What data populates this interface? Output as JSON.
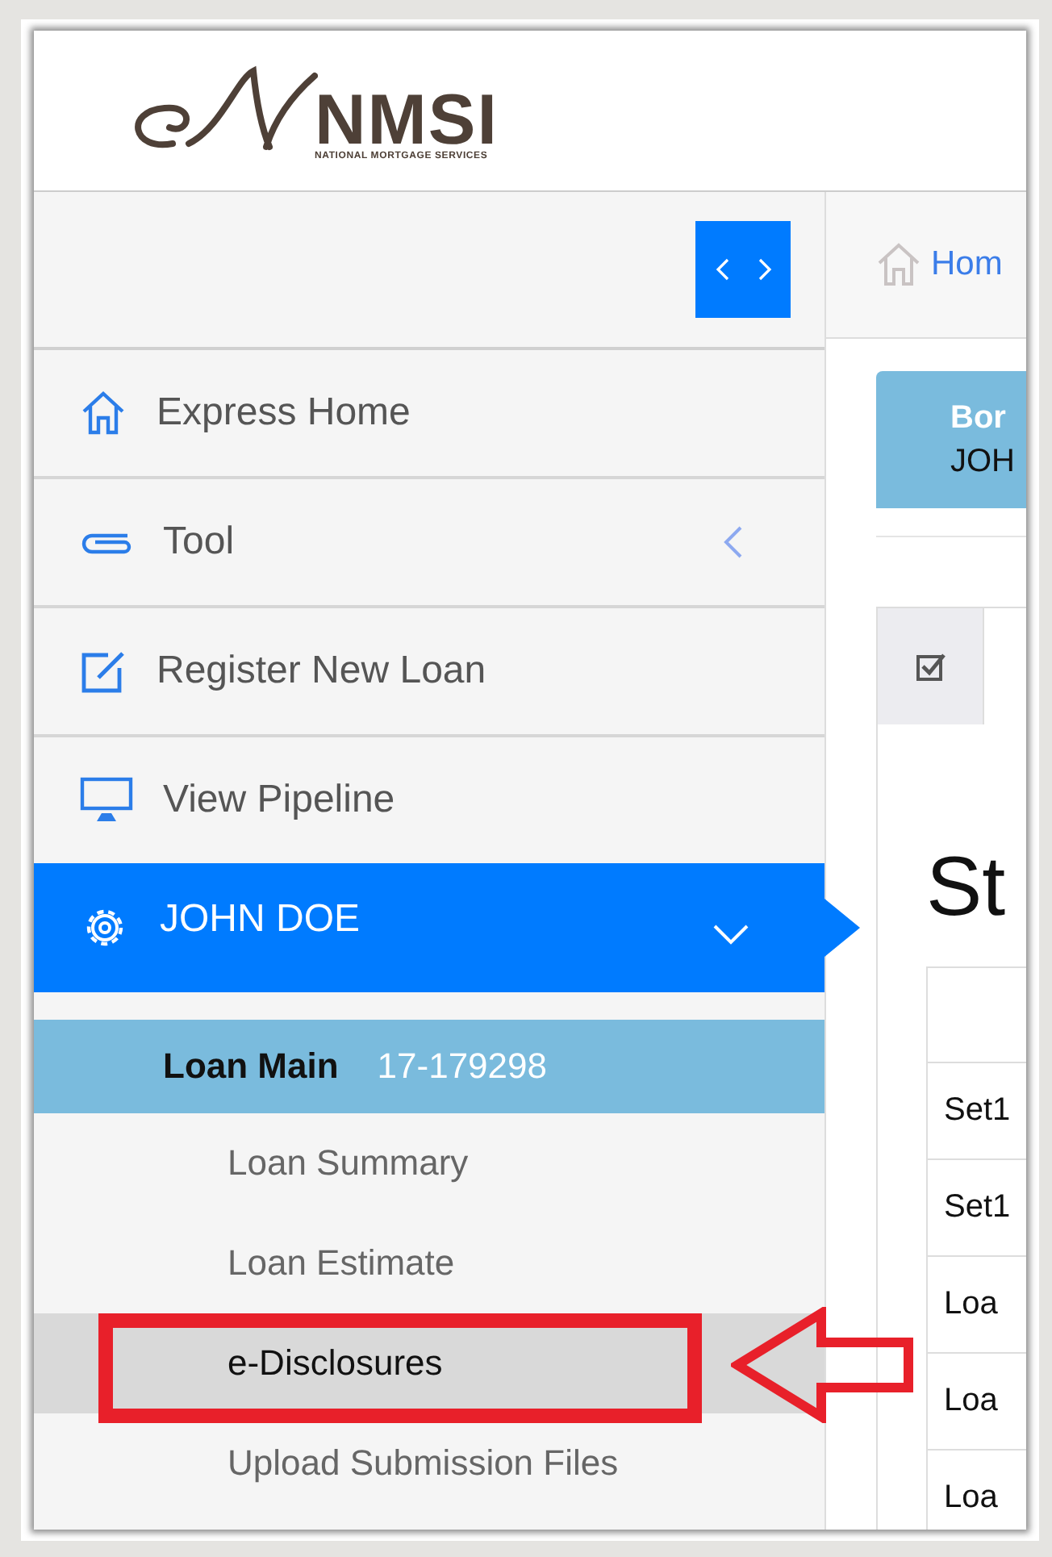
{
  "logo": {
    "name": "NMSI",
    "tagline": "NATIONAL MORTGAGE SERVICES"
  },
  "sidebar": {
    "items": [
      {
        "label": "Express Home",
        "kind": "link",
        "selected": false
      },
      {
        "label": "Tool",
        "kind": "group",
        "expanded": false,
        "selected": false
      },
      {
        "label": "Register New Loan",
        "kind": "link",
        "selected": false
      },
      {
        "label": "View Pipeline",
        "kind": "link",
        "selected": false
      },
      {
        "label": "JOHN DOE",
        "kind": "group",
        "expanded": true,
        "selected": true
      }
    ]
  },
  "loan_main": {
    "label": "Loan Main",
    "number": "17-179298"
  },
  "submenu": [
    {
      "label": "Loan Summary",
      "selected": false,
      "highlighted": false
    },
    {
      "label": "Loan Estimate",
      "selected": false,
      "highlighted": false
    },
    {
      "label": "e-Disclosures",
      "selected": true,
      "highlighted": true
    },
    {
      "label": "Upload Submission Files",
      "selected": false,
      "highlighted": false
    }
  ],
  "breadcrumb": {
    "label": "Hom"
  },
  "borrower": {
    "label": "Bor",
    "value": "JOH"
  },
  "heading": "St",
  "table_rows": [
    "Set1",
    "Set1",
    "Loa",
    "Loa",
    "Loa"
  ]
}
